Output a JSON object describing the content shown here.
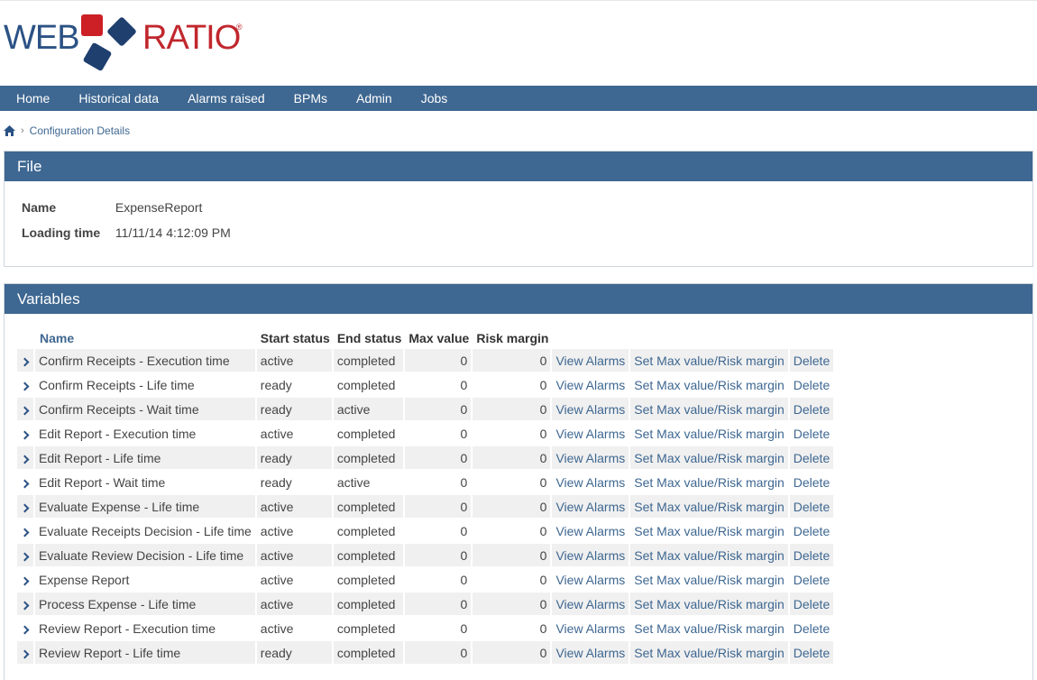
{
  "logo": {
    "part1": "WEB",
    "part2": "RATIO",
    "reg": "®"
  },
  "nav": [
    {
      "label": "Home"
    },
    {
      "label": "Historical data"
    },
    {
      "label": "Alarms raised"
    },
    {
      "label": "BPMs"
    },
    {
      "label": "Admin"
    },
    {
      "label": "Jobs"
    }
  ],
  "breadcrumb": {
    "current": "Configuration Details"
  },
  "file": {
    "title": "File",
    "name_label": "Name",
    "name_value": "ExpenseReport",
    "loading_label": "Loading time",
    "loading_value": "11/11/14 4:12:09 PM"
  },
  "variables": {
    "title": "Variables",
    "headers": [
      "Name",
      "Start status",
      "End status",
      "Max value",
      "Risk margin"
    ],
    "action_view": "View Alarms",
    "action_set": "Set Max value/Risk margin",
    "action_delete": "Delete",
    "rows": [
      {
        "name": "Confirm Receipts - Execution time",
        "start": "active",
        "end": "completed",
        "max": "0",
        "risk": "0"
      },
      {
        "name": "Confirm Receipts - Life time",
        "start": "ready",
        "end": "completed",
        "max": "0",
        "risk": "0"
      },
      {
        "name": "Confirm Receipts - Wait time",
        "start": "ready",
        "end": "active",
        "max": "0",
        "risk": "0"
      },
      {
        "name": "Edit Report - Execution time",
        "start": "active",
        "end": "completed",
        "max": "0",
        "risk": "0"
      },
      {
        "name": "Edit Report - Life time",
        "start": "ready",
        "end": "completed",
        "max": "0",
        "risk": "0"
      },
      {
        "name": "Edit Report - Wait time",
        "start": "ready",
        "end": "active",
        "max": "0",
        "risk": "0"
      },
      {
        "name": "Evaluate Expense - Life time",
        "start": "active",
        "end": "completed",
        "max": "0",
        "risk": "0"
      },
      {
        "name": "Evaluate Receipts Decision - Life time",
        "start": "active",
        "end": "completed",
        "max": "0",
        "risk": "0"
      },
      {
        "name": "Evaluate Review Decision - Life time",
        "start": "active",
        "end": "completed",
        "max": "0",
        "risk": "0"
      },
      {
        "name": "Expense Report",
        "start": "active",
        "end": "completed",
        "max": "0",
        "risk": "0"
      },
      {
        "name": "Process Expense - Life time",
        "start": "active",
        "end": "completed",
        "max": "0",
        "risk": "0"
      },
      {
        "name": "Review Report - Execution time",
        "start": "active",
        "end": "completed",
        "max": "0",
        "risk": "0"
      },
      {
        "name": "Review Report - Life time",
        "start": "ready",
        "end": "completed",
        "max": "0",
        "risk": "0"
      }
    ]
  },
  "colors": {
    "brand_blue": "#3e6791",
    "logo_red": "#c1272d",
    "logo_navy": "#1f3f6e"
  }
}
